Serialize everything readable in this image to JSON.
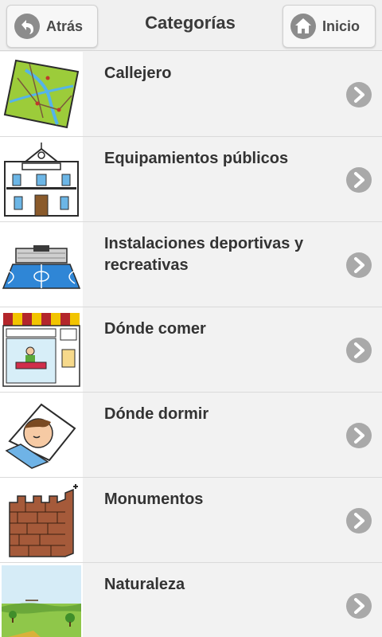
{
  "header": {
    "title": "Categorías",
    "back_label": "Atrás",
    "home_label": "Inicio"
  },
  "categories": [
    {
      "label": "Callejero",
      "icon": "map-icon"
    },
    {
      "label": "Equipamientos públicos",
      "icon": "town-hall-icon"
    },
    {
      "label": "Instalaciones deportivas y recreativas",
      "icon": "sports-court-icon"
    },
    {
      "label": "Dónde comer",
      "icon": "restaurant-icon"
    },
    {
      "label": "Dónde dormir",
      "icon": "sleeping-icon"
    },
    {
      "label": "Monumentos",
      "icon": "wall-icon"
    },
    {
      "label": "Naturaleza",
      "icon": "landscape-icon"
    }
  ],
  "colors": {
    "header_bg": "#f0f0f0",
    "row_bg": "#f2f2f2",
    "chevron": "#a9a9a9",
    "text": "#333333"
  }
}
